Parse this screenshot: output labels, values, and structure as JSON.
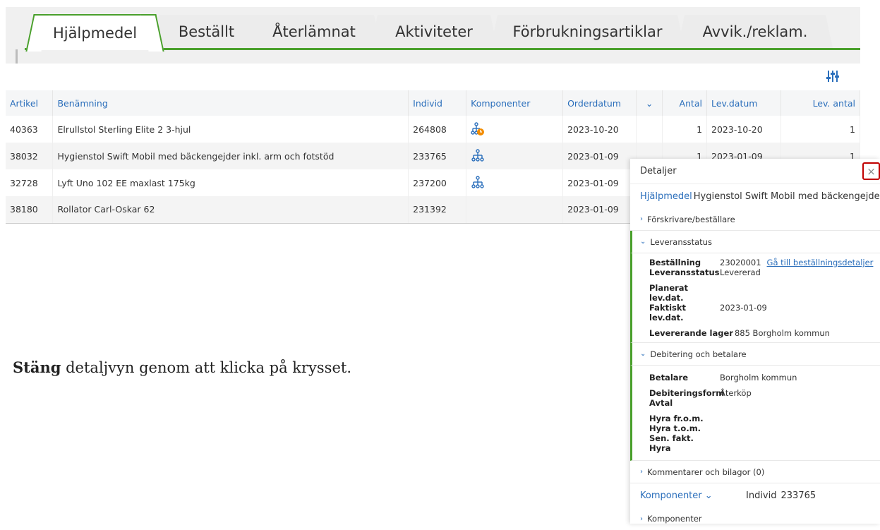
{
  "tabs": [
    {
      "label": "Hjälpmedel",
      "active": true
    },
    {
      "label": "Beställt"
    },
    {
      "label": "Återlämnat"
    },
    {
      "label": "Aktiviteter"
    },
    {
      "label": "Förbrukningsartiklar"
    },
    {
      "label": "Avvik./reklam."
    }
  ],
  "table": {
    "headers": {
      "artikel": "Artikel",
      "benamning": "Benämning",
      "individ": "Individ",
      "komponenter": "Komponenter",
      "orderdatum": "Orderdatum",
      "sort": "⌄",
      "antal": "Antal",
      "levdatum": "Lev.datum",
      "levantal": "Lev. antal"
    },
    "rows": [
      {
        "artikel": "40363",
        "benamning": "Elrullstol Sterling Elite 2 3-hjul",
        "individ": "264808",
        "komponent_icon": "hierarchy-clock-icon",
        "orderdatum": "2023-10-20",
        "antal": "1",
        "levdatum": "2023-10-20",
        "levantal": "1"
      },
      {
        "artikel": "38032",
        "benamning": "Hygienstol Swift Mobil med bäckengejder inkl. arm och fotstöd",
        "individ": "233765",
        "komponent_icon": "hierarchy-icon",
        "orderdatum": "2023-01-09",
        "antal": "1",
        "levdatum": "2023-01-09",
        "levantal": "1"
      },
      {
        "artikel": "32728",
        "benamning": "Lyft Uno 102 EE maxlast 175kg",
        "individ": "237200",
        "komponent_icon": "hierarchy-icon",
        "orderdatum": "2023-01-09",
        "antal": "",
        "levdatum": "",
        "levantal": ""
      },
      {
        "artikel": "38180",
        "benamning": "Rollator Carl-Oskar 62",
        "individ": "231392",
        "komponent_icon": "",
        "orderdatum": "2023-01-09",
        "antal": "",
        "levdatum": "",
        "levantal": ""
      }
    ]
  },
  "instruction": {
    "bold": "Stäng",
    "rest": " detaljvyn genom att klicka på krysset."
  },
  "panel": {
    "header": "Detaljer",
    "close": "×",
    "title_category": "Hjälpmedel",
    "title_text": "Hygienstol Swift Mobil med bäckengejder in...",
    "sections": {
      "forskrivare": "Förskrivare/beställare",
      "leveransstatus": "Leveransstatus",
      "debitering": "Debitering och betalare",
      "kommentarer": "Kommentarer och bilagor",
      "kommentarer_count": "(0)",
      "komponenter": "Komponenter"
    },
    "leverans": {
      "bestallning_label": "Beställning",
      "bestallning_value": "23020001",
      "bestallning_link": "Gå till beställningsdetaljer",
      "status_label": "Leveransstatus",
      "status_value": "Levererad",
      "planerat_label": "Planerat lev.dat.",
      "faktiskt_label": "Faktiskt lev.dat.",
      "faktiskt_value": "2023-01-09",
      "lager_label": "Levererande lager",
      "lager_value": "885 Borgholm kommun"
    },
    "debitering": {
      "betalare_label": "Betalare",
      "betalare_value": "Borgholm kommun",
      "form_label": "Debiteringsform",
      "form_value": "Återköp",
      "avtal_label": "Avtal",
      "hyra_from_label": "Hyra fr.o.m.",
      "hyra_tom_label": "Hyra t.o.m.",
      "sen_fakt_label": "Sen. fakt.",
      "hyra_label": "Hyra"
    },
    "bottom": {
      "dropdown_label": "Komponenter ⌄",
      "individ_label": "Individ",
      "individ_value": "233765"
    }
  }
}
